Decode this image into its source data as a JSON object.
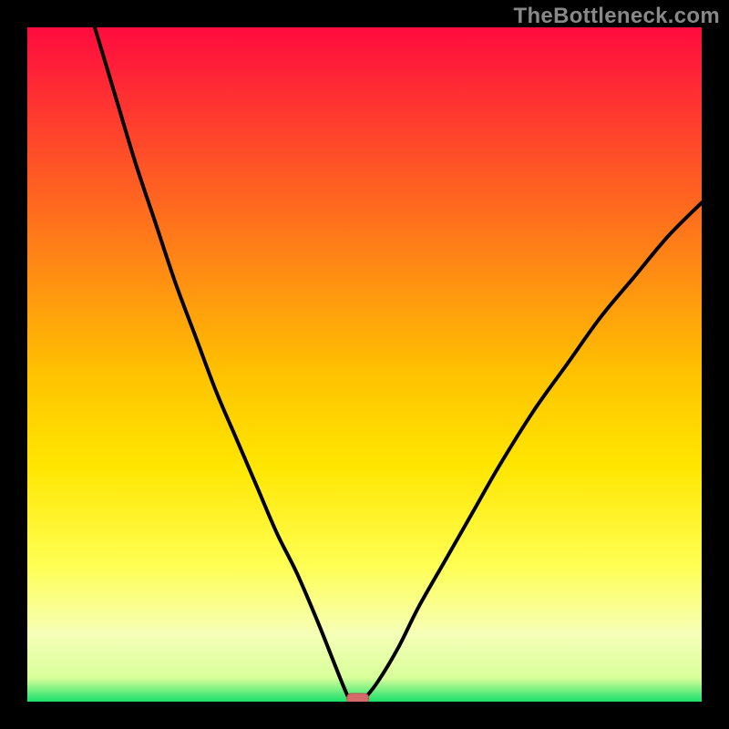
{
  "watermark": "TheBottleneck.com",
  "colors": {
    "background": "#000000",
    "curve": "#000000",
    "marker_fill": "#d46a6a",
    "marker_stroke": "#bb5555",
    "gradient_top": "#ff0b3f",
    "gradient_yellow": "#ffe600",
    "gradient_pale": "#f6ffb8",
    "gradient_green": "#18e06a"
  },
  "chart_data": {
    "type": "line",
    "title": "",
    "xlabel": "",
    "ylabel": "",
    "xlim": [
      0,
      100
    ],
    "ylim": [
      0,
      100
    ],
    "grid": false,
    "legend": false,
    "marker": {
      "x": 49,
      "y": 0
    },
    "series": [
      {
        "name": "bottleneck-curve",
        "x": [
          10,
          13,
          16,
          19,
          22,
          25,
          28,
          31,
          34,
          37,
          40,
          43,
          45,
          47,
          48,
          49,
          50,
          52,
          55,
          58,
          62,
          66,
          70,
          75,
          80,
          85,
          90,
          95,
          100
        ],
        "y": [
          100,
          90,
          80,
          71,
          62,
          54,
          46,
          39,
          32,
          25,
          19,
          12,
          7,
          2,
          0,
          0,
          0.5,
          3,
          8,
          14,
          21,
          28,
          35,
          43,
          50,
          57,
          63,
          69,
          74
        ]
      }
    ]
  }
}
